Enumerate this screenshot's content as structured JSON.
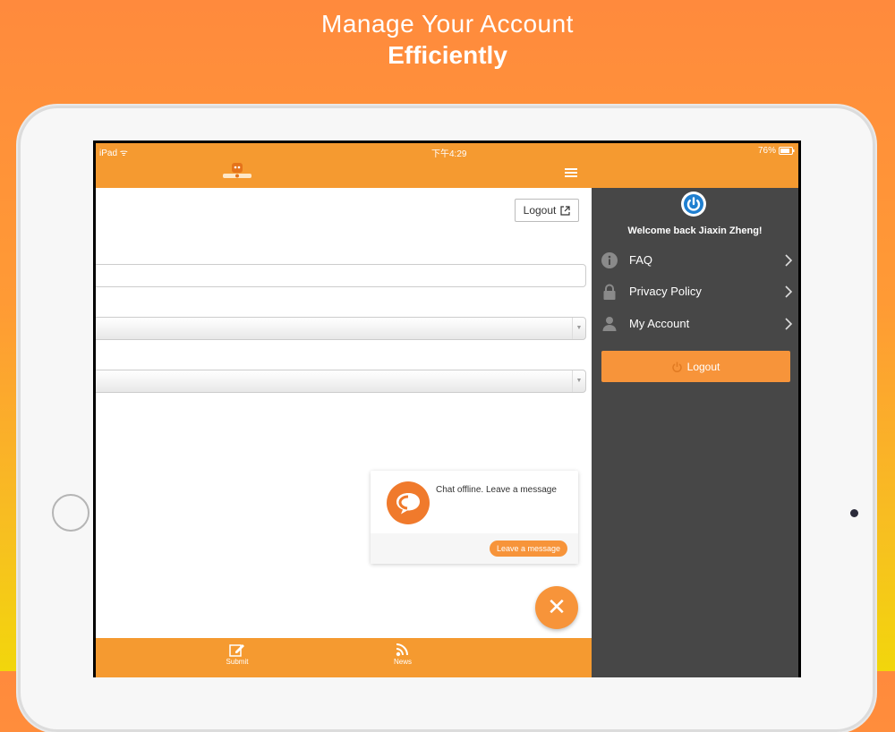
{
  "promo": {
    "line1": "Manage Your Account",
    "line2": "Efficiently"
  },
  "status_bar": {
    "device": "iPad",
    "time": "下午4:29",
    "battery": "76%"
  },
  "header": {
    "logo_icon": "mascot-logo-icon",
    "menu_icon": "hamburger-icon"
  },
  "toolbar": {
    "logout_label": "Logout"
  },
  "chat": {
    "message": "Chat offline. Leave a message",
    "button_label": "Leave a message"
  },
  "tabbar": {
    "items": [
      {
        "label": "Submit",
        "icon": "edit-icon"
      },
      {
        "label": "News",
        "icon": "rss-icon"
      }
    ]
  },
  "drawer": {
    "welcome": "Welcome back Jiaxin Zheng!",
    "items": [
      {
        "label": "FAQ",
        "icon": "info-icon"
      },
      {
        "label": "Privacy Policy",
        "icon": "lock-icon"
      },
      {
        "label": "My Account",
        "icon": "user-icon"
      }
    ],
    "logout_label": "Logout"
  },
  "colors": {
    "accent": "#f7943a",
    "drawer_bg": "#474747"
  }
}
